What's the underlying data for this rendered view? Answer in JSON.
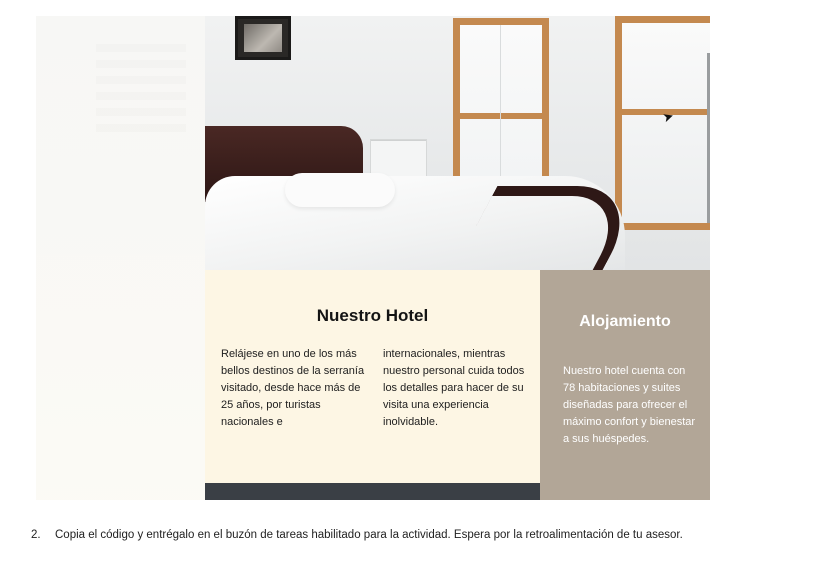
{
  "hotel_panel": {
    "title": "Nuestro Hotel",
    "column_1": "Relájese en uno de los más bellos destinos de la serranía visitado, desde hace más de 25 años, por turistas nacionales e",
    "column_2": "internacionales, mientras nuestro personal cuida todos los detalles para hacer de su visita una experiencia inolvidable.",
    "background": "#fdf6e4"
  },
  "accommodation_panel": {
    "title": "Alojamiento",
    "text": "Nuestro hotel cuenta con 78 habitaciones y suites diseñadas para ofrecer el máximo confort y bienestar a sus huéspedes.",
    "background": "#b2a697"
  },
  "cursor": {
    "glyph": "➤",
    "icon": "mouse-pointer-icon"
  },
  "instruction": {
    "number": "2.",
    "text": "Copia el código y entrégalo en el buzón de tareas habilitado para la actividad. Espera por la retroalimentación de tu asesor."
  }
}
